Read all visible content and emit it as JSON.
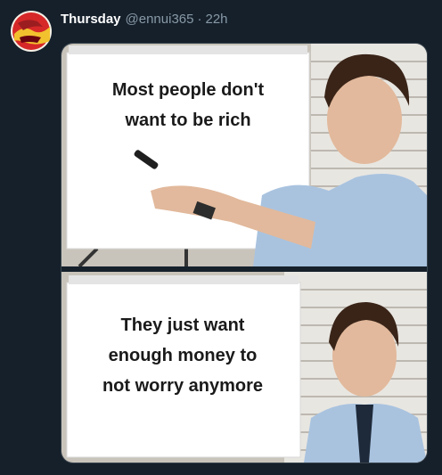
{
  "tweet": {
    "display_name": "Thursday",
    "handle": "@ennui365",
    "separator": "·",
    "time": "22h"
  },
  "meme": {
    "panel_top_lines": [
      "Most people don't",
      "want to be rich"
    ],
    "panel_bottom_lines": [
      "They just want",
      "enough money to",
      "not worry anymore"
    ]
  },
  "colors": {
    "background": "#15202b",
    "name": "#ffffff",
    "secondary": "#8899a6"
  }
}
